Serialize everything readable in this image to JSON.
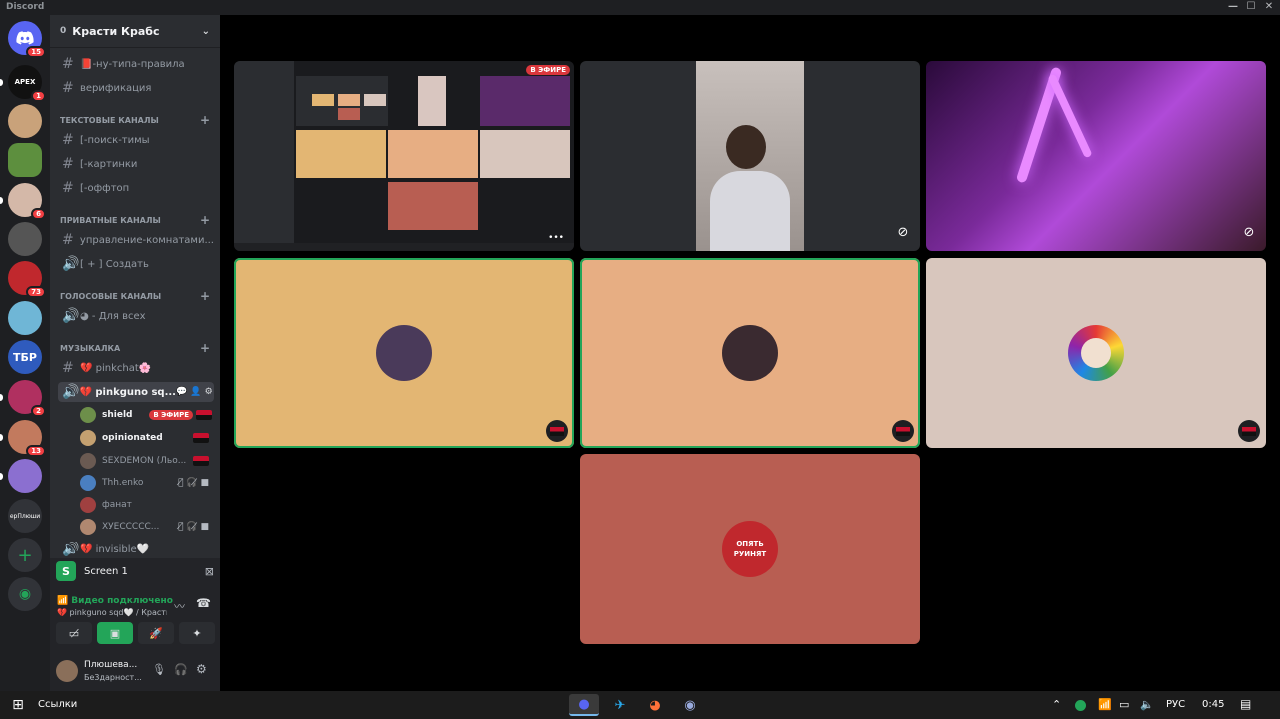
{
  "window": {
    "title": "Discord"
  },
  "servers": [
    {
      "name": "Discord",
      "badge": "15",
      "color": "#5865f2"
    },
    {
      "name": "APEX",
      "badge": "1",
      "color": "#111111"
    },
    {
      "name": "server-3",
      "badge": "",
      "color": "#c9a27a"
    },
    {
      "name": "server-4",
      "badge": "",
      "color": "#5d8f3e"
    },
    {
      "name": "server-5",
      "badge": "6",
      "color": "#d4b8a8"
    },
    {
      "name": "server-6",
      "badge": "",
      "color": "#555555"
    },
    {
      "name": "server-7",
      "badge": "73",
      "color": "#c0282d"
    },
    {
      "name": "server-8",
      "badge": "",
      "color": "#6fb6d6"
    },
    {
      "name": "ТБР",
      "badge": "",
      "color": "#2f5bbd"
    },
    {
      "name": "server-10",
      "badge": "2",
      "color": "#b03060"
    },
    {
      "name": "server-11",
      "badge": "13",
      "color": "#c27a5e"
    },
    {
      "name": "server-12",
      "badge": "",
      "color": "#8b6fd0"
    },
    {
      "name": "ерПлюши",
      "badge": "",
      "color": "#313338"
    }
  ],
  "server": {
    "name": "Красти Крабс",
    "count": "0"
  },
  "channels": {
    "top": [
      {
        "name": "📕-ну-типа-правила"
      },
      {
        "name": "верификация"
      }
    ],
    "text_category": "ТЕКСТОВЫЕ КАНАЛЫ",
    "text": [
      {
        "name": "[-поиск-тимы"
      },
      {
        "name": "[-картинки"
      },
      {
        "name": "[-оффтоп"
      }
    ],
    "private_category": "ПРИВАТНЫЕ КАНАЛЫ",
    "private": [
      {
        "name": "управление-комнатами..."
      },
      {
        "name": "[ + ] Создать"
      }
    ],
    "voice_category": "ГОЛОСОВЫЕ КАНАЛЫ",
    "voice": [
      {
        "name": "◕ - Для всех"
      }
    ],
    "music_category": "МУЗЫКАЛКА",
    "music": [
      {
        "name": "💔 pinkchat🌸"
      },
      {
        "name": "💔 pinkguno sq..."
      }
    ],
    "more": "💔 invisible🤍"
  },
  "members": [
    {
      "name": "shield",
      "live": "В ЭФИРЕ",
      "color": "#6d8f4a"
    },
    {
      "name": "opinionated",
      "live": "",
      "color": "#c4a070"
    },
    {
      "name": "SEXDEMON (Льо...",
      "live": "",
      "color": "#6a5a52"
    },
    {
      "name": "Thh.enko",
      "live": "",
      "color": "#4a7fc0"
    },
    {
      "name": "фанат",
      "live": "",
      "color": "#a04040"
    },
    {
      "name": "ХУЕССССС...",
      "live": "",
      "color": "#b08870"
    }
  ],
  "stream_panel": {
    "letter": "S",
    "label": "Screen 1"
  },
  "voice_status": {
    "title": "Видео подключено",
    "subtitle": "💔 pinkguno sqd🤍 / Красти..."
  },
  "user": {
    "name": "Плюшева...",
    "status": "Бе3дарност..."
  },
  "tiles": {
    "live_label": "В ЭФИРЕ",
    "t4_color": "#e3b673",
    "t5_color": "#e7ae83",
    "t6_color": "#d8c6bd",
    "t7_color": "#b85e52",
    "t7_text": "ОПЯТЬ РУИНЯТ",
    "more": "•••"
  },
  "taskbar": {
    "links": "Ссылки",
    "lang": "РУС",
    "time": "0:45"
  }
}
